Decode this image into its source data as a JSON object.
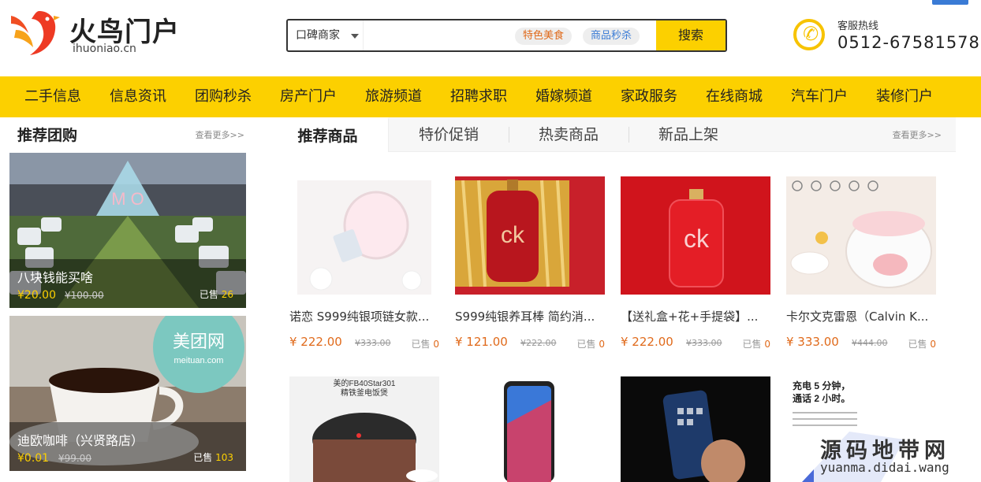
{
  "header": {
    "logo_name": "火鸟门户",
    "logo_domain": "ihuoniao.cn",
    "search": {
      "type_label": "口碑商家",
      "placeholder": "",
      "tags": [
        "特色美食",
        "商品秒杀"
      ],
      "button_label": "搜索"
    },
    "hotline": {
      "label": "客服热线",
      "number": "0512-67581578"
    }
  },
  "nav": {
    "items": [
      "二手信息",
      "信息资讯",
      "团购秒杀",
      "房产门户",
      "旅游频道",
      "招聘求职",
      "婚嫁频道",
      "家政服务",
      "在线商城",
      "汽车门户",
      "装修门户"
    ]
  },
  "sidebar": {
    "title": "推荐团购",
    "more_label": "查看更多>>",
    "deals": [
      {
        "name": "八块钱能买啥",
        "price": "¥20.00",
        "old_price": "¥100.00",
        "sold_label": "已售",
        "sold": "26"
      },
      {
        "name": "迪欧咖啡（兴贤路店）",
        "price": "¥0.01",
        "old_price": "¥99.00",
        "sold_label": "已售",
        "sold": "103"
      }
    ]
  },
  "main": {
    "tabs": [
      "推荐商品",
      "特价促销",
      "热卖商品",
      "新品上架"
    ],
    "more_label": "查看更多>>",
    "products": [
      {
        "name": "诺恋 S999纯银项链女款...",
        "price": "¥ 222.00",
        "old_price": "¥333.00",
        "sold_label": "已售",
        "sold": "0"
      },
      {
        "name": "S999纯银养耳棒 简约消...",
        "price": "¥ 121.00",
        "old_price": "¥222.00",
        "sold_label": "已售",
        "sold": "0"
      },
      {
        "name": "【送礼盒+花+手提袋】...",
        "price": "¥ 222.00",
        "old_price": "¥333.00",
        "sold_label": "已售",
        "sold": "0"
      },
      {
        "name": "卡尔文克雷恩（Calvin K...",
        "price": "¥ 333.00",
        "old_price": "¥444.00",
        "sold_label": "已售",
        "sold": "0"
      }
    ],
    "second_row": {
      "cooker_text_1": "美的FB40Star301",
      "cooker_text_2": "精铁釜电饭煲",
      "charge_text_1": "充电 5 分钟，",
      "charge_text_2": "通话 2 小时。"
    }
  },
  "deal_image_texts": {
    "wedding": "M  O",
    "coffee_cup": "美团网",
    "coffee_cup_en": "meituan.com"
  },
  "perfume_label": "ck",
  "watermark": {
    "cn": "源码地带网",
    "en": "yuanma.didai.wang"
  },
  "colors": {
    "brand_yellow": "#fcd000",
    "price_orange": "#e06a1b",
    "tag_blue": "#3a7bd5"
  }
}
